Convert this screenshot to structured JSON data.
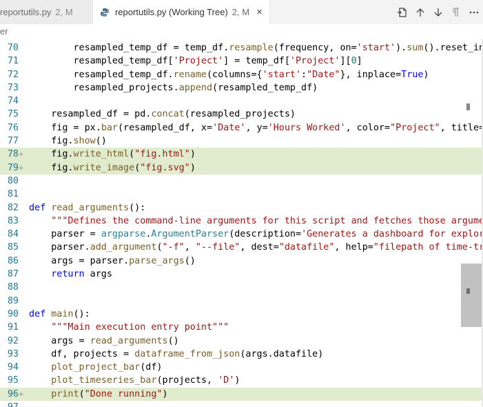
{
  "tabs": [
    {
      "label": "reportutils.py",
      "status": "2, M",
      "active": false
    },
    {
      "label": "reportutils.py (Working Tree)",
      "status": "2, M",
      "active": true,
      "close": "×"
    }
  ],
  "breadcrumb": "er",
  "editor": {
    "lines": [
      {
        "num": "70",
        "added": false,
        "marker": "",
        "code": "        resampled_temp_df = temp_df.resample(frequency, on='start').sum().reset_inde"
      },
      {
        "num": "71",
        "added": false,
        "marker": "",
        "code": "        resampled_temp_df['Project'] = temp_df['Project'][0]"
      },
      {
        "num": "72",
        "added": false,
        "marker": "",
        "code": "        resampled_temp_df.rename(columns={'start':\"Date\"}, inplace=True)"
      },
      {
        "num": "73",
        "added": false,
        "marker": "",
        "code": "        resampled_projects.append(resampled_temp_df)"
      },
      {
        "num": "74",
        "added": false,
        "marker": "",
        "code": ""
      },
      {
        "num": "75",
        "added": false,
        "marker": "",
        "code": "    resampled_df = pd.concat(resampled_projects)"
      },
      {
        "num": "76",
        "added": false,
        "marker": "",
        "code": "    fig = px.bar(resampled_df, x='Date', y='Hours Worked', color=\"Project\", title='"
      },
      {
        "num": "77",
        "added": false,
        "marker": "",
        "code": "    fig.show()"
      },
      {
        "num": "78",
        "added": true,
        "marker": "+",
        "code": "    fig.write_html(\"fig.html\")"
      },
      {
        "num": "79",
        "added": true,
        "marker": "+",
        "code": "    fig.write_image(\"fig.svg\")"
      },
      {
        "num": "80",
        "added": false,
        "marker": "",
        "code": ""
      },
      {
        "num": "81",
        "added": false,
        "marker": "",
        "code": ""
      },
      {
        "num": "82",
        "added": false,
        "marker": "",
        "code": "def read_arguments():"
      },
      {
        "num": "83",
        "added": false,
        "marker": "",
        "code": "    \"\"\"Defines the command-line arguments for this script and fetches those argument"
      },
      {
        "num": "84",
        "added": false,
        "marker": "",
        "code": "    parser = argparse.ArgumentParser(description='Generates a dashboard for explorin"
      },
      {
        "num": "85",
        "added": false,
        "marker": "",
        "code": "    parser.add_argument(\"-f\", \"--file\", dest=\"datafile\", help=\"filepath of time-trac"
      },
      {
        "num": "86",
        "added": false,
        "marker": "",
        "code": "    args = parser.parse_args()"
      },
      {
        "num": "87",
        "added": false,
        "marker": "",
        "code": "    return args"
      },
      {
        "num": "88",
        "added": false,
        "marker": "",
        "code": ""
      },
      {
        "num": "89",
        "added": false,
        "marker": "",
        "code": ""
      },
      {
        "num": "90",
        "added": false,
        "marker": "",
        "code": "def main():"
      },
      {
        "num": "91",
        "added": false,
        "marker": "",
        "code": "    \"\"\"Main execution entry point\"\"\""
      },
      {
        "num": "92",
        "added": false,
        "marker": "",
        "code": "    args = read_arguments()"
      },
      {
        "num": "93",
        "added": false,
        "marker": "",
        "code": "    df, projects = dataframe_from_json(args.datafile)"
      },
      {
        "num": "94",
        "added": false,
        "marker": "",
        "code": "    plot_project_bar(df)"
      },
      {
        "num": "95",
        "added": false,
        "marker": "",
        "code": "    plot_timeseries_bar(projects, 'D')"
      },
      {
        "num": "96",
        "added": true,
        "marker": "+",
        "code": "    print(\"Done running\")"
      },
      {
        "num": "97",
        "added": false,
        "marker": "",
        "code": ""
      }
    ]
  },
  "colors": {
    "added_line": "#e1ebcd",
    "line_number": "#237893",
    "keyword": "#0000ff",
    "string": "#a31515",
    "function": "#795e26"
  },
  "icons": [
    "python-file-icon",
    "open-changes-icon",
    "previous-change-icon",
    "next-change-icon",
    "show-whitespace-icon",
    "more-actions-icon"
  ]
}
